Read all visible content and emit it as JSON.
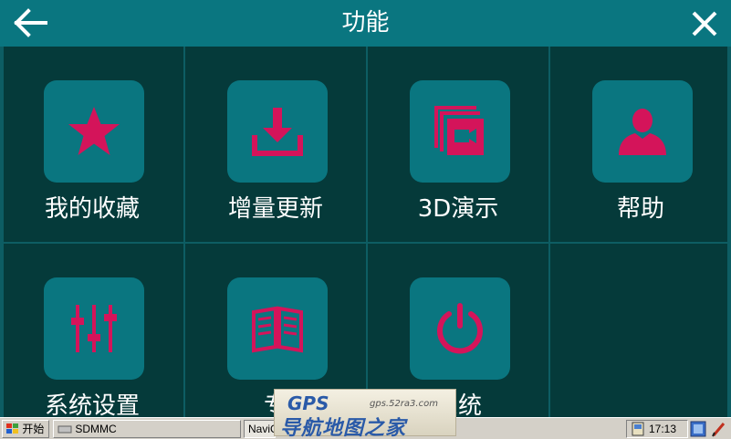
{
  "header": {
    "title": "功能",
    "back_icon": "arrow-left-icon",
    "close_icon": "close-icon"
  },
  "colors": {
    "header_bg": "#0a7680",
    "grid_bg": "#053a3a",
    "tile_bg": "#0a7680",
    "icon_accent": "#d4145a"
  },
  "tiles": [
    {
      "label": "我的收藏",
      "icon": "star-icon"
    },
    {
      "label": "增量更新",
      "icon": "download-icon"
    },
    {
      "label": "3D演示",
      "icon": "video-icon"
    },
    {
      "label": "帮助",
      "icon": "user-icon"
    },
    {
      "label": "系统设置",
      "icon": "sliders-icon"
    },
    {
      "label": "专",
      "icon": "book-icon"
    },
    {
      "label": "系统",
      "icon": "power-icon"
    }
  ],
  "taskbar": {
    "start_label": "开始",
    "task1_label": "SDMMC",
    "task2_label": "NaviC",
    "time": "17:13"
  },
  "watermark": {
    "brand": "GPS",
    "url": "gps.52ra3.com",
    "name": "导航地图之家"
  }
}
